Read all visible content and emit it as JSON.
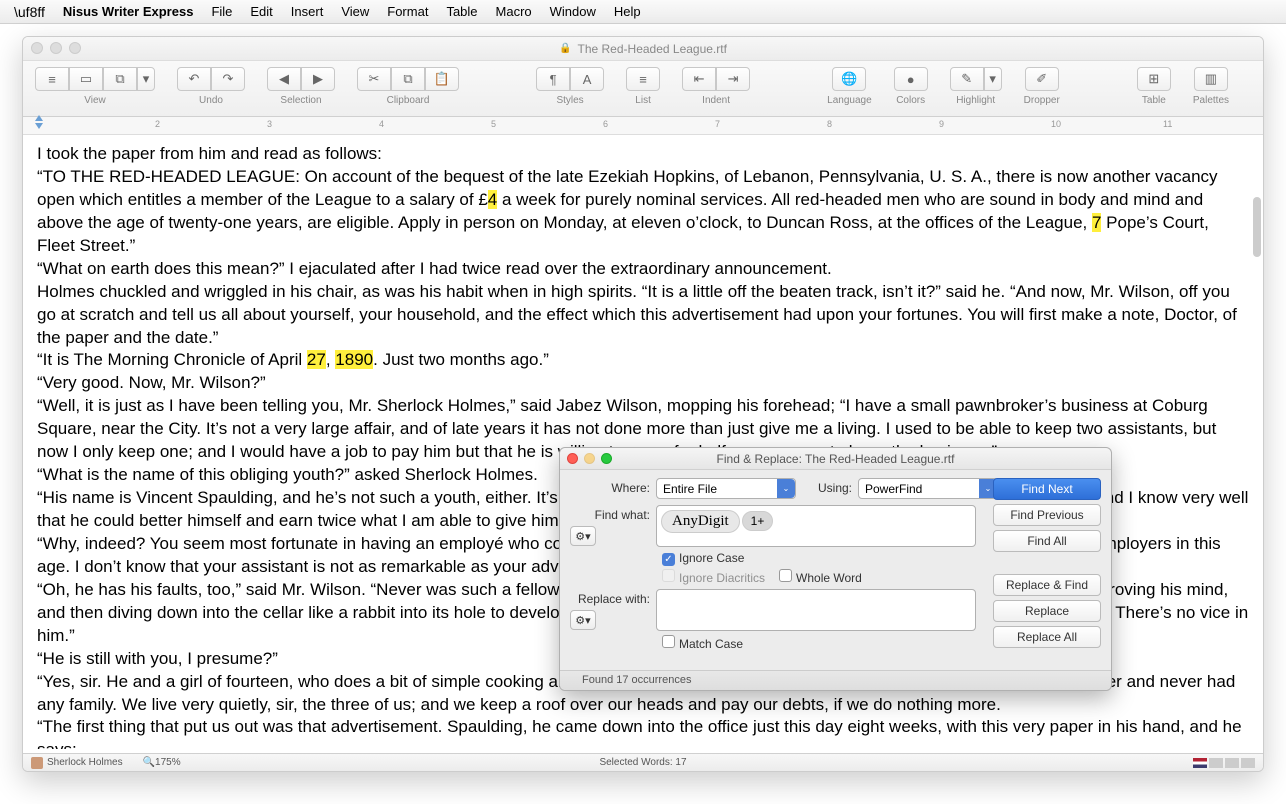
{
  "menubar": {
    "app": "Nisus Writer Express",
    "items": [
      "File",
      "Edit",
      "Insert",
      "View",
      "Format",
      "Table",
      "Macro",
      "Window",
      "Help"
    ]
  },
  "window": {
    "title": "The Red-Headed League.rtf"
  },
  "toolbar": {
    "view": "View",
    "undo": "Undo",
    "selection": "Selection",
    "clipboard": "Clipboard",
    "styles": "Styles",
    "list": "List",
    "indent": "Indent",
    "language": "Language",
    "colors": "Colors",
    "highlight": "Highlight",
    "dropper": "Dropper",
    "table": "Table",
    "palettes": "Palettes"
  },
  "ruler": {
    "ticks": [
      "2",
      "3",
      "4",
      "5",
      "6",
      "7",
      "8",
      "9",
      "10",
      "11"
    ]
  },
  "document": {
    "p1": "I took the paper from him and read as follows:",
    "p2a": "“TO THE RED-HEADED LEAGUE: On account of the bequest of the late Ezekiah Hopkins, of Lebanon, Pennsylvania, U. S. A., there is now another vacancy open which entitles a member of the League to a salary of £",
    "p2h1": "4",
    "p2b": " a week for purely nominal services. All red-headed men who are sound in body and mind and above the age of twenty-one years, are eligible. Apply in person on Monday, at eleven o’clock, to Duncan Ross, at the offices of the League, ",
    "p2h2": "7",
    "p2c": " Pope’s Court, Fleet Street.”",
    "p3": "“What on earth does this mean?” I ejaculated after I had twice read over the extraordinary announcement.",
    "p4": "Holmes chuckled and wriggled in his chair, as was his habit when in high spirits. “It is a little off the beaten track, isn’t it?” said he. “And now, Mr. Wilson, off you go at scratch and tell us all about yourself, your household, and the effect which this advertisement had upon your fortunes. You will first make a note, Doctor, of the paper and the date.”",
    "p5a": "“It is The Morning Chronicle of April ",
    "p5h1": "27",
    "p5b": ", ",
    "p5h2": "1890",
    "p5c": ". Just two months ago.”",
    "p6": "“Very good. Now, Mr. Wilson?”",
    "p7": "“Well, it is just as I have been telling you, Mr. Sherlock Holmes,” said Jabez Wilson, mopping his forehead; “I have a small pawnbroker’s business at Coburg Square, near the City. It’s not a very large affair, and of late years it has not done more than just give me a living. I used to be able to keep two assistants, but now I only keep one; and I would have a job to pay him but that he is willing to come for half wages so as to learn the business.”",
    "p8": "“What is the name of this obliging youth?” asked Sherlock Holmes.",
    "p9": "“His name is Vincent Spaulding, and he’s not such a youth, either. It’s hard to say his age. I should not wish a smarter assistant, Mr. Holmes; and I know very well that he could better himself and earn twice what I am able to give him. But, after all, if he is satisfied, why should I put ideas in his head?”",
    "p10": "“Why, indeed? You seem most fortunate in having an employé who comes under the full market price. It is not a common experience among employers in this age. I don’t know that your assistant is not as remarkable as your advertisement.”",
    "p11": "“Oh, he has his faults, too,” said Mr. Wilson. “Never was such a fellow for photography. Snapping away with a camera when he ought to be improving his mind, and then diving down into the cellar like a rabbit into its hole to develop his pictures. That is his main fault, but on the whole he’s a good worker. There’s no vice in him.”",
    "p12": "“He is still with you, I presume?”",
    "p13": "“Yes, sir. He and a girl of fourteen, who does a bit of simple cooking and keeps the place clean—that’s all I have in the house, for I am a widower and never had any family. We live very quietly, sir, the three of us; and we keep a roof over our heads and pay our debts, if we do nothing more.",
    "p14": "“The first thing that put us out was that advertisement. Spaulding, he came down into the office just this day eight weeks, with this very paper in his hand, and he says:"
  },
  "statusbar": {
    "author": "Sherlock Holmes",
    "zoom": "175%",
    "selection": "Selected Words: 17"
  },
  "dialog": {
    "title": "Find & Replace: The Red-Headed League.rtf",
    "where_label": "Where:",
    "where_value": "Entire File",
    "using_label": "Using:",
    "using_value": "PowerFind",
    "find_label": "Find what:",
    "find_pill1": "AnyDigit",
    "find_pill2": "1+",
    "replace_label": "Replace with:",
    "ignore_case": "Ignore Case",
    "ignore_diacritics": "Ignore Diacritics",
    "whole_word": "Whole Word",
    "match_case": "Match Case",
    "btn_find_next": "Find Next",
    "btn_find_prev": "Find Previous",
    "btn_find_all": "Find All",
    "btn_replace_find": "Replace & Find",
    "btn_replace": "Replace",
    "btn_replace_all": "Replace All",
    "footer": "Found 17 occurrences"
  }
}
